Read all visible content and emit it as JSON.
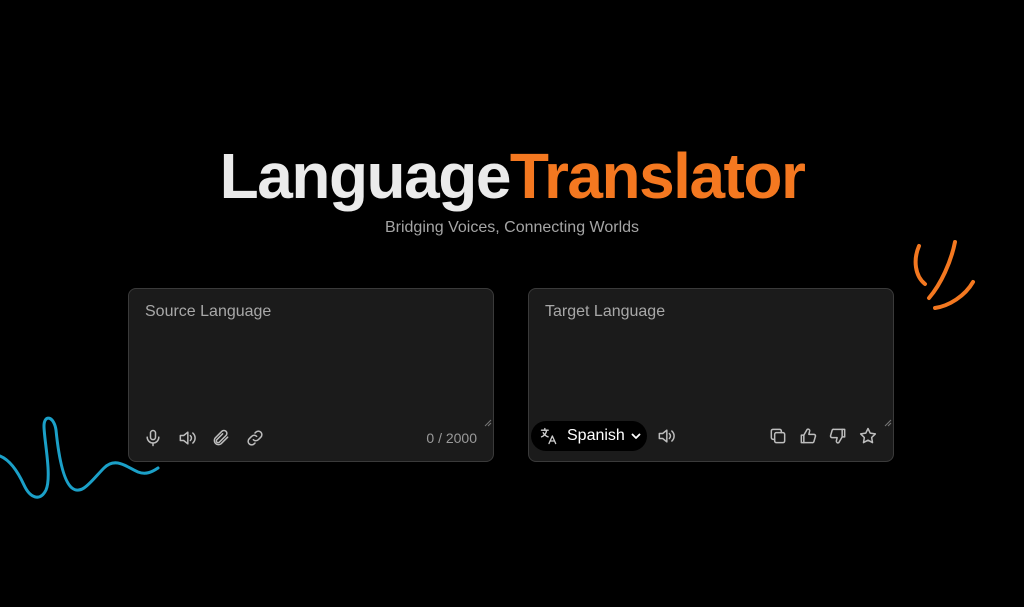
{
  "header": {
    "title_part1": "Language",
    "title_part2": "Translator",
    "subtitle": "Bridging Voices, Connecting Worlds"
  },
  "source": {
    "placeholder": "Source Language",
    "value": "",
    "counter": "0 / 2000",
    "icons": [
      "microphone-icon",
      "speaker-icon",
      "paperclip-icon",
      "link-icon"
    ]
  },
  "target": {
    "placeholder": "Target Language",
    "value": "",
    "language_selected": "Spanish",
    "icons": [
      "translate-icon",
      "chevron-down-icon",
      "speaker-icon",
      "copy-icon",
      "thumbs-up-icon",
      "thumbs-down-icon",
      "star-icon"
    ]
  },
  "colors": {
    "background": "#000000",
    "accent": "#f47820",
    "title_light": "#ebebeb",
    "card_bg": "#1b1b1b",
    "squiggle_blue": "#1ba0c8"
  }
}
